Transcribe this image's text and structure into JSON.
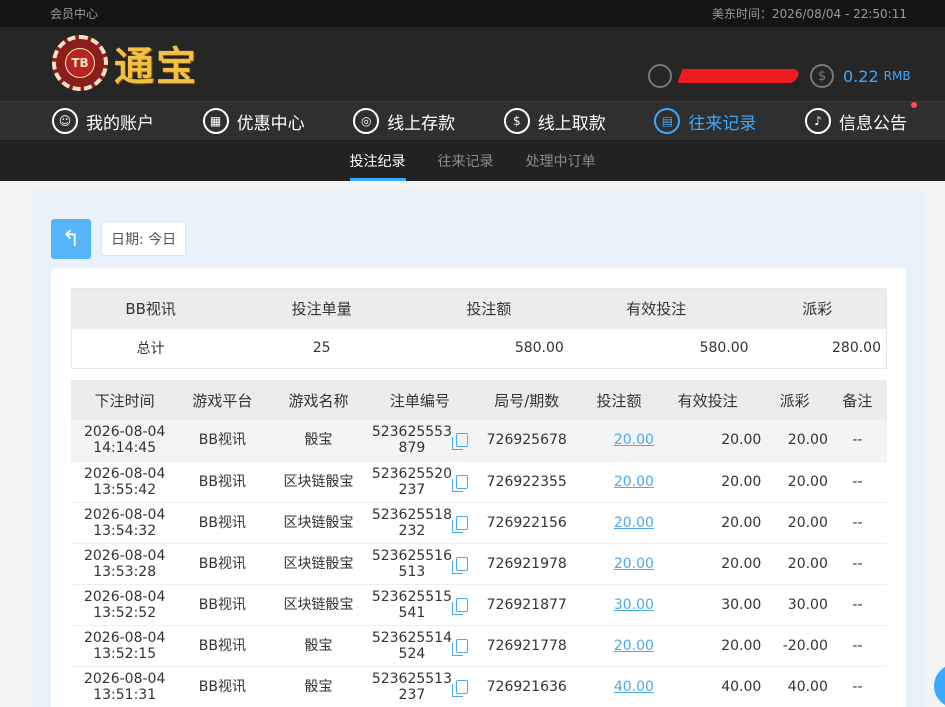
{
  "topbar": {
    "left": "会员中心",
    "right": "美东时间：2026/08/04 - 22:50:11"
  },
  "header": {
    "logo_chip": "TB",
    "logo_text": "通宝",
    "balance_value": "0.22",
    "balance_unit": "RMB",
    "balance_icon": "$"
  },
  "nav": [
    {
      "label": "我的账户",
      "icon": "user-icon"
    },
    {
      "label": "优惠中心",
      "icon": "gift-icon"
    },
    {
      "label": "线上存款",
      "icon": "deposit-icon"
    },
    {
      "label": "线上取款",
      "icon": "withdraw-icon"
    },
    {
      "label": "往来记录",
      "icon": "records-icon",
      "active": true
    },
    {
      "label": "信息公告",
      "icon": "bell-icon"
    }
  ],
  "subnav": [
    {
      "label": "投注纪录",
      "active": true
    },
    {
      "label": "往来记录"
    },
    {
      "label": "处理中订单"
    }
  ],
  "back_icon": "↰",
  "date_label": "日期: 今日",
  "summary": {
    "headers": [
      "BB视讯",
      "投注单量",
      "投注额",
      "有效投注",
      "派彩"
    ],
    "row": [
      "总计",
      "25",
      "580.00",
      "580.00",
      "280.00"
    ]
  },
  "detail": {
    "headers": [
      "下注时间",
      "游戏平台",
      "游戏名称",
      "注单编号",
      "局号/期数",
      "投注额",
      "有效投注",
      "派彩",
      "备注"
    ],
    "rows": [
      {
        "date": "2026-08-04",
        "time": "14:14:45",
        "platform": "BB视讯",
        "game": "骰宝",
        "order_a": "523625553",
        "order_b": "879",
        "round": "726925678",
        "bet": "20.00",
        "valid": "20.00",
        "payout": "20.00",
        "note": "--"
      },
      {
        "date": "2026-08-04",
        "time": "13:55:42",
        "platform": "BB视讯",
        "game": "区块链骰宝",
        "order_a": "523625520",
        "order_b": "237",
        "round": "726922355",
        "bet": "20.00",
        "valid": "20.00",
        "payout": "20.00",
        "note": "--"
      },
      {
        "date": "2026-08-04",
        "time": "13:54:32",
        "platform": "BB视讯",
        "game": "区块链骰宝",
        "order_a": "523625518",
        "order_b": "232",
        "round": "726922156",
        "bet": "20.00",
        "valid": "20.00",
        "payout": "20.00",
        "note": "--"
      },
      {
        "date": "2026-08-04",
        "time": "13:53:28",
        "platform": "BB视讯",
        "game": "区块链骰宝",
        "order_a": "523625516",
        "order_b": "513",
        "round": "726921978",
        "bet": "20.00",
        "valid": "20.00",
        "payout": "20.00",
        "note": "--"
      },
      {
        "date": "2026-08-04",
        "time": "13:52:52",
        "platform": "BB视讯",
        "game": "区块链骰宝",
        "order_a": "523625515",
        "order_b": "541",
        "round": "726921877",
        "bet": "30.00",
        "valid": "30.00",
        "payout": "30.00",
        "note": "--"
      },
      {
        "date": "2026-08-04",
        "time": "13:52:15",
        "platform": "BB视讯",
        "game": "骰宝",
        "order_a": "523625514",
        "order_b": "524",
        "round": "726921778",
        "bet": "20.00",
        "valid": "20.00",
        "payout": "-20.00",
        "note": "--"
      },
      {
        "date": "2026-08-04",
        "time": "13:51:31",
        "platform": "BB视讯",
        "game": "骰宝",
        "order_a": "523625513",
        "order_b": "237",
        "round": "726921636",
        "bet": "40.00",
        "valid": "40.00",
        "payout": "40.00",
        "note": "--"
      }
    ]
  },
  "colors": {
    "accent": "#3ba9ff",
    "negative": "#f0464a",
    "redaction": "#ee1c1c"
  }
}
